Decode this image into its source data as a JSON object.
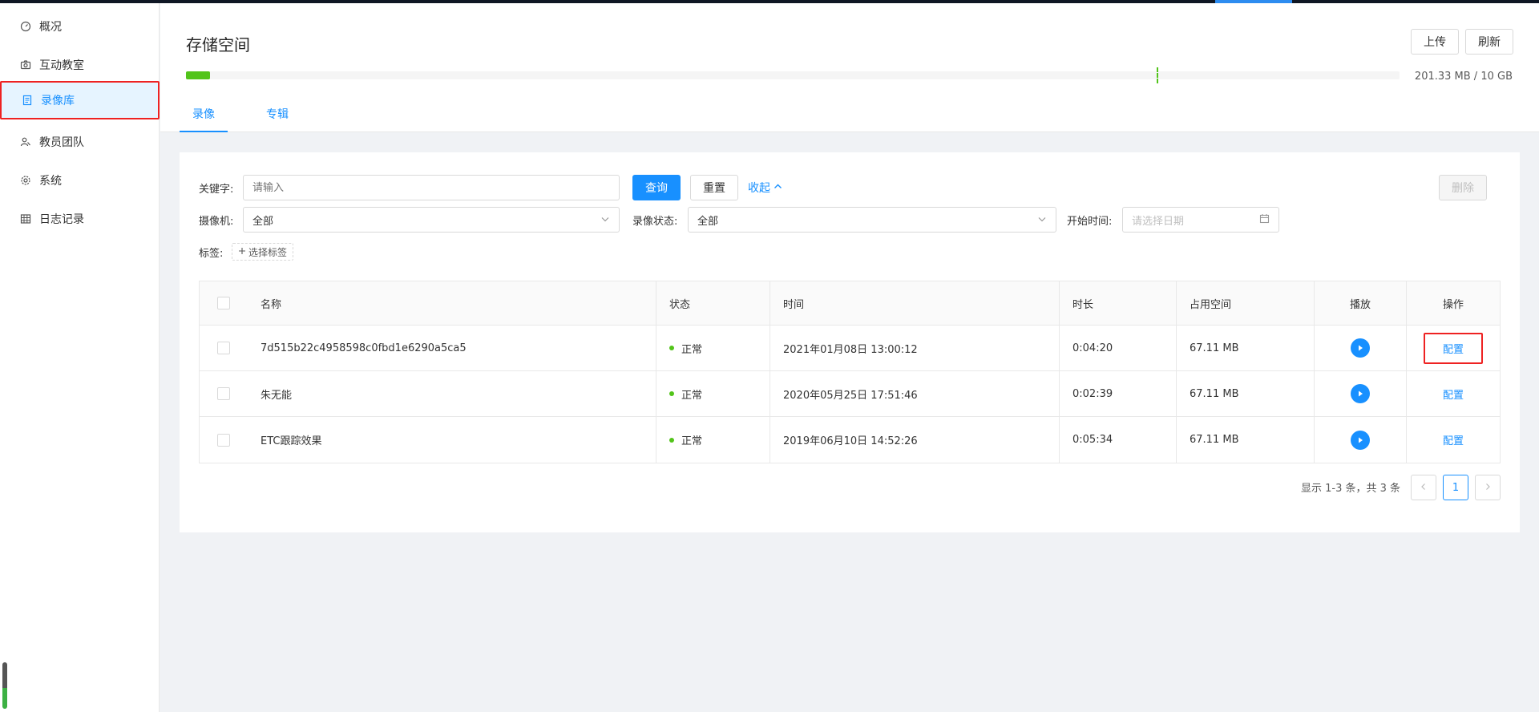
{
  "sidebar": {
    "items": [
      {
        "label": "概况",
        "icon": "dashboard-icon"
      },
      {
        "label": "互动教室",
        "icon": "camera-icon"
      },
      {
        "label": "录像库",
        "icon": "book-icon"
      },
      {
        "label": "教员团队",
        "icon": "team-icon"
      },
      {
        "label": "系统",
        "icon": "gear-icon"
      },
      {
        "label": "日志记录",
        "icon": "table-icon"
      }
    ]
  },
  "header": {
    "title": "存储空间",
    "upload_label": "上传",
    "refresh_label": "刷新",
    "storage": {
      "used_fraction": 0.02,
      "marker_fraction": 0.8,
      "text": "201.33 MB / 10 GB"
    },
    "tabs": [
      {
        "label": "录像"
      },
      {
        "label": "专辑"
      }
    ]
  },
  "filters": {
    "keyword_label": "关键字:",
    "keyword_placeholder": "请输入",
    "query_label": "查询",
    "reset_label": "重置",
    "collapse_label": "收起",
    "delete_label": "删除",
    "camera_label": "摄像机:",
    "camera_value": "全部",
    "status_label": "录像状态:",
    "status_value": "全部",
    "start_label": "开始时间:",
    "start_placeholder": "请选择日期",
    "tag_label": "标签:",
    "tag_button": "选择标签"
  },
  "table": {
    "columns": [
      "名称",
      "状态",
      "时间",
      "时长",
      "占用空间",
      "播放",
      "操作"
    ],
    "rows": [
      {
        "name": "7d515b22c4958598c0fbd1e6290a5ca5",
        "status": "正常",
        "time": "2021年01月08日 13:00:12",
        "duration": "0:04:20",
        "size": "67.11 MB",
        "action": "配置"
      },
      {
        "name": "朱无能",
        "status": "正常",
        "time": "2020年05月25日 17:51:46",
        "duration": "0:02:39",
        "size": "67.11 MB",
        "action": "配置"
      },
      {
        "name": "ETC跟踪效果",
        "status": "正常",
        "time": "2019年06月10日 14:52:26",
        "duration": "0:05:34",
        "size": "67.11 MB",
        "action": "配置"
      }
    ]
  },
  "pagination": {
    "summary": "显示 1-3 条，共 3 条",
    "current_page": "1"
  },
  "colors": {
    "accent": "#1890ff",
    "success": "#52c41a",
    "highlight": "#ee2222"
  }
}
